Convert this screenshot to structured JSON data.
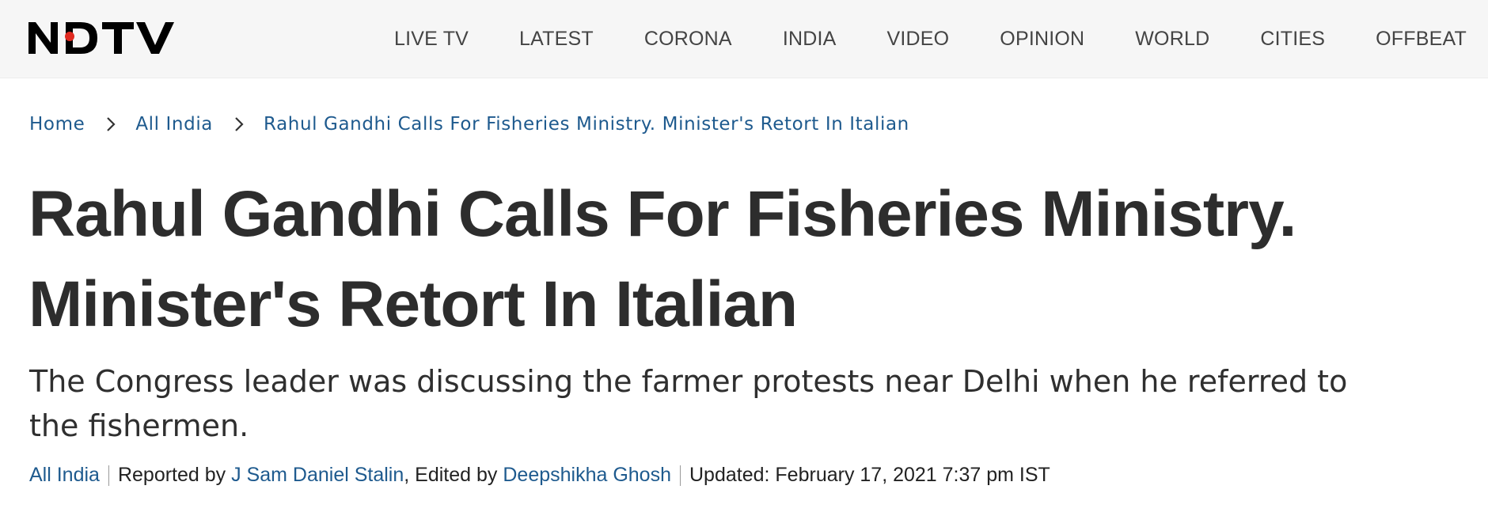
{
  "header": {
    "logo_text": "NDTV",
    "brand_color": "#000000",
    "logo_dot_color": "#e02a20",
    "nav": [
      {
        "label": "LIVE TV"
      },
      {
        "label": "LATEST"
      },
      {
        "label": "CORONA"
      },
      {
        "label": "INDIA"
      },
      {
        "label": "VIDEO"
      },
      {
        "label": "OPINION"
      },
      {
        "label": "WORLD"
      },
      {
        "label": "CITIES"
      },
      {
        "label": "OFFBEAT"
      }
    ]
  },
  "breadcrumb": {
    "items": [
      {
        "label": "Home"
      },
      {
        "label": "All India"
      },
      {
        "label": "Rahul Gandhi Calls For Fisheries Ministry. Minister's Retort In Italian"
      }
    ],
    "separator_icon": "chevron-right-icon",
    "link_color": "#1e5a8e"
  },
  "article": {
    "headline": "Rahul Gandhi Calls For Fisheries Ministry. Minister's Retort In Italian",
    "summary": "The Congress leader was discussing the farmer protests near Delhi when he referred to the fishermen.",
    "byline": {
      "category": "All India",
      "reported_prefix": "Reported by",
      "reporter": "J Sam Daniel Stalin",
      "edited_prefix": ", Edited by",
      "editor": "Deepshikha Ghosh",
      "updated": "Updated: February 17, 2021 7:37 pm IST"
    }
  }
}
